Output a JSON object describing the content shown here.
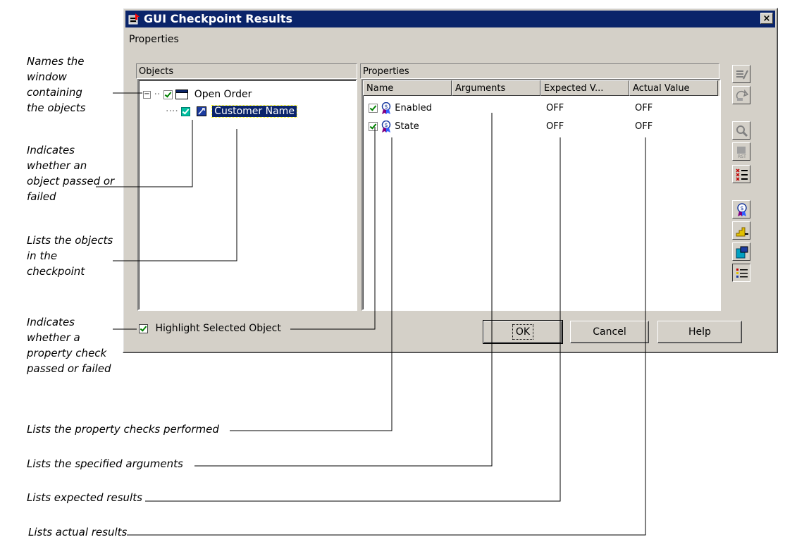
{
  "window": {
    "title": "GUI Checkpoint Results",
    "menu": "Properties",
    "close_glyph": "×"
  },
  "objects_panel": {
    "header": "Objects",
    "tree": [
      {
        "label": "Open Order",
        "checked": true,
        "icon": "window-icon",
        "expander": "−"
      },
      {
        "label": "Customer Name",
        "checked": true,
        "icon": "edit-field-icon",
        "selected": true
      }
    ]
  },
  "properties_panel": {
    "header": "Properties",
    "columns": [
      "Name",
      "Arguments",
      "Expected V...",
      "Actual Value"
    ],
    "rows": [
      {
        "name": "Enabled",
        "arguments": "",
        "expected": "OFF",
        "actual": "OFF"
      },
      {
        "name": "State",
        "arguments": "",
        "expected": "OFF",
        "actual": "OFF"
      }
    ]
  },
  "highlight_checkbox": {
    "label": "Highlight Selected Object",
    "checked": true
  },
  "buttons": {
    "ok": "OK",
    "cancel": "Cancel",
    "help": "Help"
  },
  "toolbar_icons": [
    "edit-expected-icon",
    "update-expected-icon",
    "zoom-icon",
    "reset-icon",
    "failed-list-icon",
    "property-icon",
    "steps-icon",
    "window-blue-icon",
    "list-icon"
  ],
  "annotations": {
    "window_names": [
      "Names the",
      "window",
      "containing",
      "the objects"
    ],
    "object_pass": [
      "Indicates",
      "whether an",
      "object passed or",
      "failed"
    ],
    "lists_objects": [
      "Lists the objects",
      "in the",
      "checkpoint"
    ],
    "property_pass": [
      "Indicates",
      "whether a",
      "property check",
      "passed or failed"
    ],
    "property_checks": "Lists the property checks performed",
    "arguments": "Lists the specified arguments",
    "expected": "Lists expected results",
    "actual": "Lists actual results"
  },
  "colors": {
    "title_bar": "#0a246a",
    "window_face": "#d4d0c8",
    "selection": "#0a246a",
    "check_green": "#008000"
  }
}
